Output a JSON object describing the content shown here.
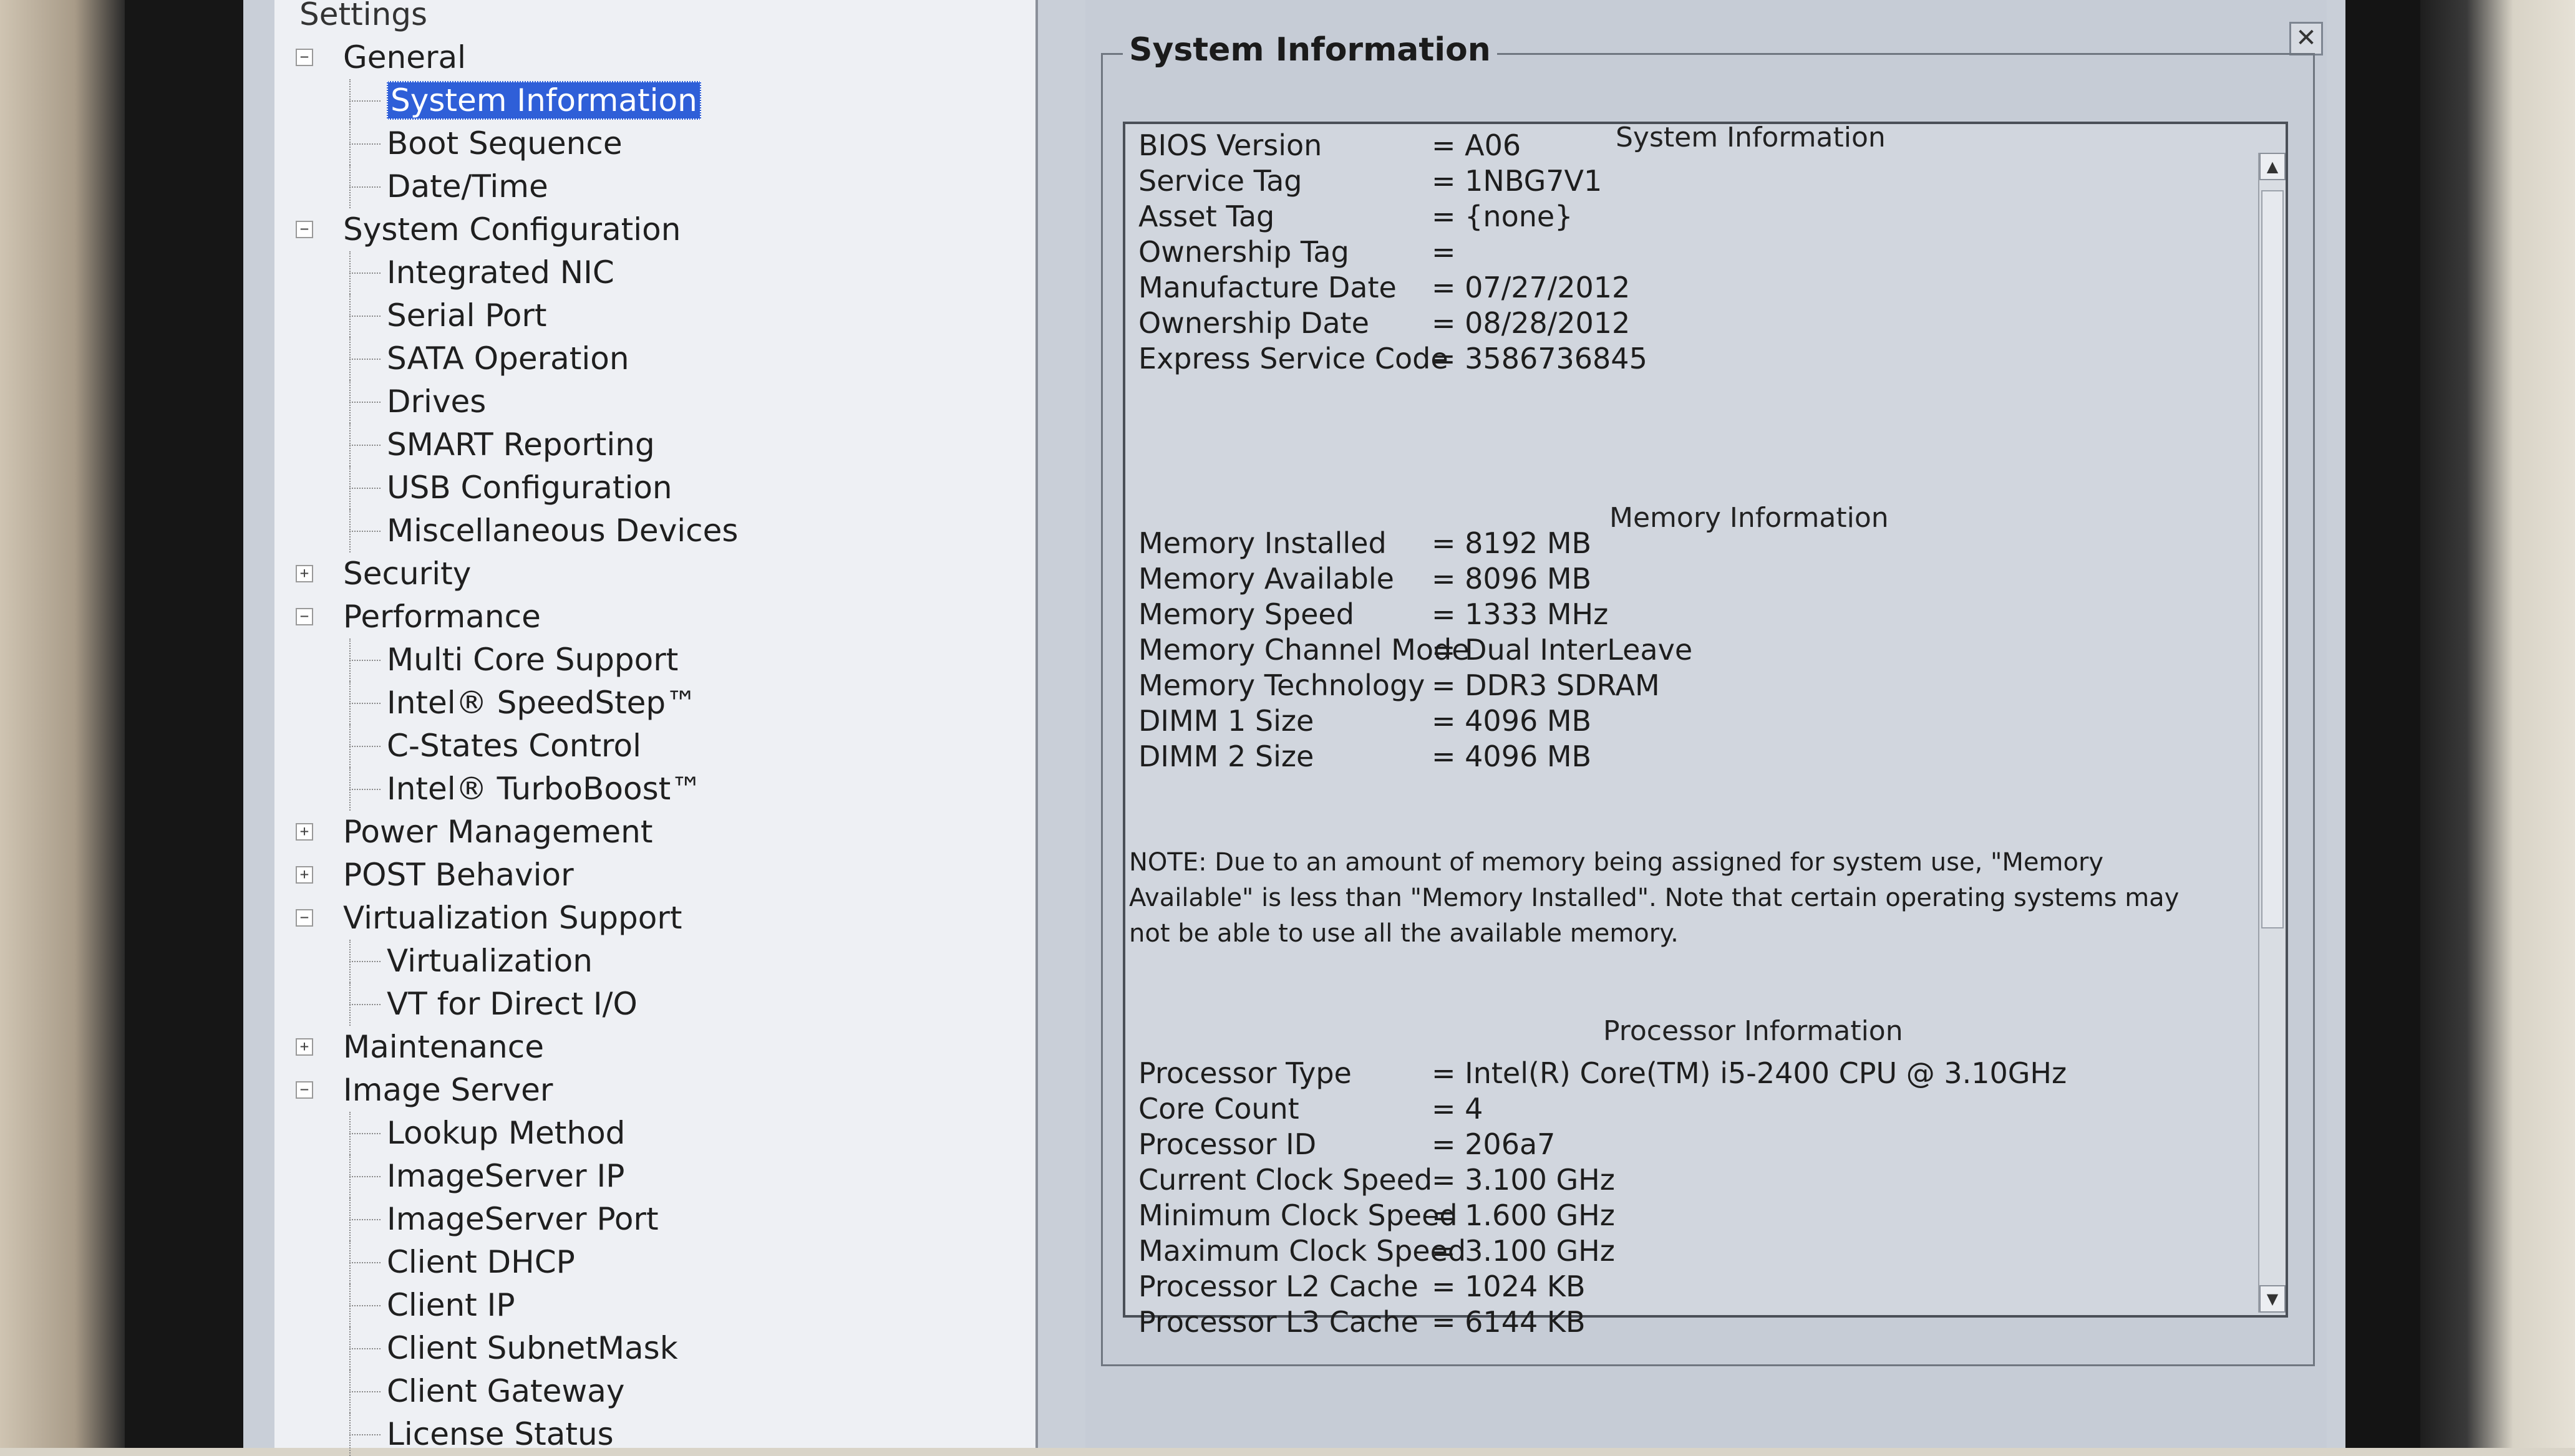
{
  "tree": {
    "title": "Settings",
    "items": [
      {
        "label": "General",
        "level": 0,
        "expander": "−"
      },
      {
        "label": "System Information",
        "level": 1,
        "selected": true
      },
      {
        "label": "Boot Sequence",
        "level": 1
      },
      {
        "label": "Date/Time",
        "level": 1
      },
      {
        "label": "System Configuration",
        "level": 0,
        "expander": "−"
      },
      {
        "label": "Integrated NIC",
        "level": 1
      },
      {
        "label": "Serial Port",
        "level": 1
      },
      {
        "label": "SATA Operation",
        "level": 1
      },
      {
        "label": "Drives",
        "level": 1
      },
      {
        "label": "SMART Reporting",
        "level": 1
      },
      {
        "label": "USB Configuration",
        "level": 1
      },
      {
        "label": "Miscellaneous Devices",
        "level": 1
      },
      {
        "label": "Security",
        "level": 0,
        "expander": "+"
      },
      {
        "label": "Performance",
        "level": 0,
        "expander": "−"
      },
      {
        "label": "Multi Core Support",
        "level": 1
      },
      {
        "label": "Intel® SpeedStep™",
        "level": 1
      },
      {
        "label": "C-States Control",
        "level": 1
      },
      {
        "label": "Intel® TurboBoost™",
        "level": 1
      },
      {
        "label": "Power Management",
        "level": 0,
        "expander": "+"
      },
      {
        "label": "POST Behavior",
        "level": 0,
        "expander": "+"
      },
      {
        "label": "Virtualization Support",
        "level": 0,
        "expander": "−"
      },
      {
        "label": "Virtualization",
        "level": 1
      },
      {
        "label": "VT for Direct I/O",
        "level": 1
      },
      {
        "label": "Maintenance",
        "level": 0,
        "expander": "+"
      },
      {
        "label": "Image Server",
        "level": 0,
        "expander": "−"
      },
      {
        "label": "Lookup Method",
        "level": 1
      },
      {
        "label": "ImageServer IP",
        "level": 1
      },
      {
        "label": "ImageServer Port",
        "level": 1
      },
      {
        "label": "Client DHCP",
        "level": 1
      },
      {
        "label": "Client IP",
        "level": 1
      },
      {
        "label": "Client SubnetMask",
        "level": 1
      },
      {
        "label": "Client Gateway",
        "level": 1
      },
      {
        "label": "License Status",
        "level": 1
      }
    ]
  },
  "panel": {
    "group_title": "System Information",
    "close_label": "✕",
    "system": {
      "heading": "System Information",
      "rows": [
        {
          "key": "BIOS Version",
          "value": "= A06"
        },
        {
          "key": "Service Tag",
          "value": "= 1NBG7V1"
        },
        {
          "key": "Asset Tag",
          "value": "= {none}"
        },
        {
          "key": "Ownership Tag",
          "value": "="
        },
        {
          "key": "Manufacture Date",
          "value": "= 07/27/2012"
        },
        {
          "key": "Ownership Date",
          "value": "= 08/28/2012"
        },
        {
          "key": "Express Service Code",
          "value": "= 3586736845"
        }
      ]
    },
    "memory": {
      "heading": "Memory Information",
      "rows": [
        {
          "key": "Memory Installed",
          "value": "= 8192 MB"
        },
        {
          "key": "Memory Available",
          "value": "= 8096 MB"
        },
        {
          "key": "Memory Speed",
          "value": "= 1333 MHz"
        },
        {
          "key": "Memory Channel Mode",
          "value": "= Dual InterLeave"
        },
        {
          "key": "Memory Technology",
          "value": "= DDR3 SDRAM"
        },
        {
          "key": "DIMM 1 Size",
          "value": "= 4096 MB"
        },
        {
          "key": "DIMM 2 Size",
          "value": "= 4096 MB"
        }
      ]
    },
    "note": "NOTE: Due to an amount of memory being assigned for system use, \"Memory Available\" is less than \"Memory Installed\". Note that certain operating systems may not be able to use all the available memory.",
    "processor": {
      "heading": "Processor Information",
      "rows": [
        {
          "key": "Processor Type",
          "value": "= Intel(R) Core(TM) i5-2400 CPU @ 3.10GHz"
        },
        {
          "key": "Core Count",
          "value": "= 4"
        },
        {
          "key": "Processor ID",
          "value": "= 206a7"
        },
        {
          "key": "Current Clock Speed",
          "value": "= 3.100 GHz"
        },
        {
          "key": "Minimum Clock Speed",
          "value": "= 1.600 GHz"
        },
        {
          "key": "Maximum Clock Speed",
          "value": "= 3.100 GHz"
        },
        {
          "key": "Processor L2 Cache",
          "value": "= 1024 KB"
        },
        {
          "key": "Processor L3 Cache",
          "value": "= 6144 KB"
        }
      ]
    },
    "scroll_up": "▲",
    "scroll_down": "▼"
  }
}
